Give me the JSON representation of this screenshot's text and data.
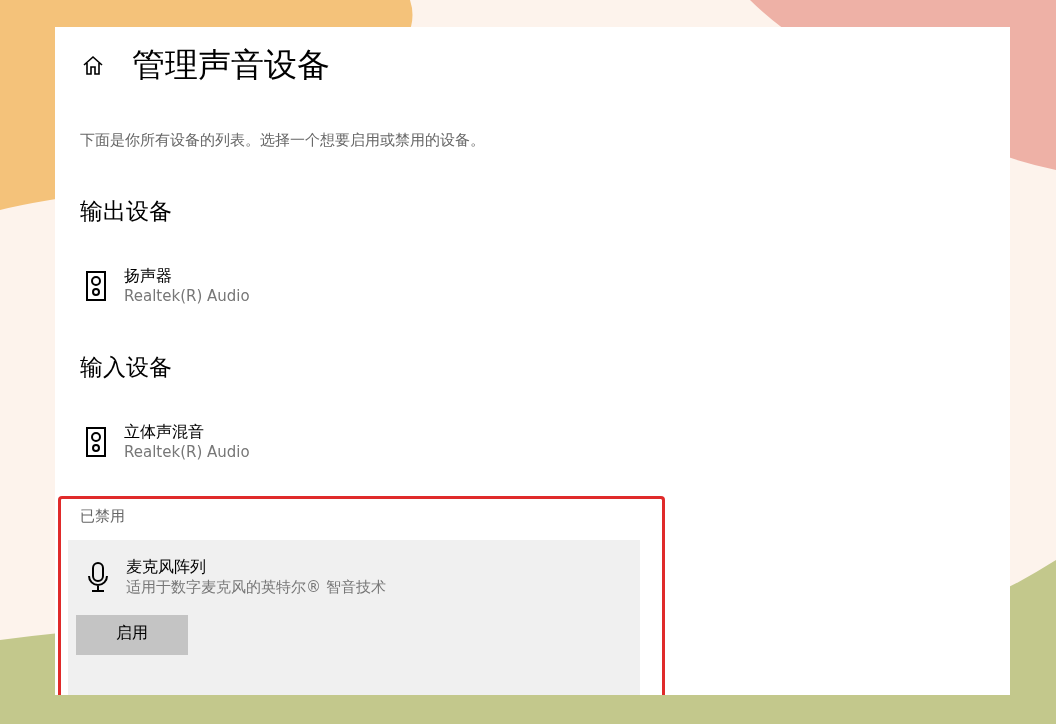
{
  "page": {
    "title": "管理声音设备",
    "description": "下面是你所有设备的列表。选择一个想要启用或禁用的设备。"
  },
  "sections": [
    {
      "heading": "输出设备",
      "devices": [
        {
          "kind": "speaker",
          "name": "扬声器",
          "detail": "Realtek(R) Audio"
        }
      ]
    },
    {
      "heading": "输入设备",
      "devices": [
        {
          "kind": "speaker",
          "name": "立体声混音",
          "detail": "Realtek(R) Audio"
        }
      ]
    }
  ],
  "disabled": {
    "label": "已禁用",
    "devices": [
      {
        "kind": "microphone",
        "name": "麦克风阵列",
        "detail": "适用于数字麦克风的英特尔® 智音技术",
        "button": "启用"
      }
    ]
  }
}
